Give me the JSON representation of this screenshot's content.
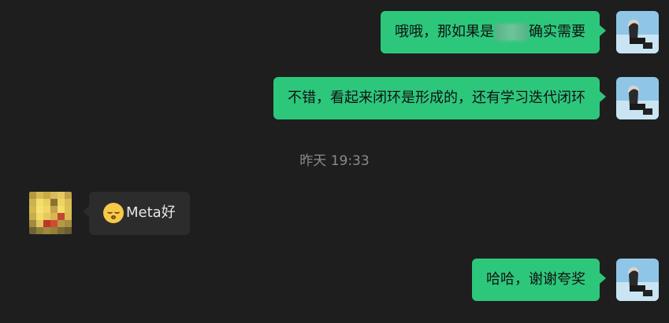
{
  "messages": [
    {
      "text_prefix": "哦哦，那如果是",
      "text_suffix": "确实需要"
    },
    {
      "text": "不错，看起来闭环是形成的，还有学习迭代闭环"
    },
    {
      "text": "Meta好"
    },
    {
      "text": "哈哈，谢谢夸奖"
    }
  ],
  "timestamp": "昨天 19:33",
  "colors": {
    "background": "#1e1e1e",
    "outgoing_bubble": "#2dc77c",
    "incoming_bubble": "#2c2c2c",
    "timestamp_text": "#8b8b8b"
  },
  "icons": {
    "self_avatar": "avatar-person-sky",
    "contact_avatar": "avatar-pixelated",
    "emoji": "relieved-face-emoji"
  }
}
